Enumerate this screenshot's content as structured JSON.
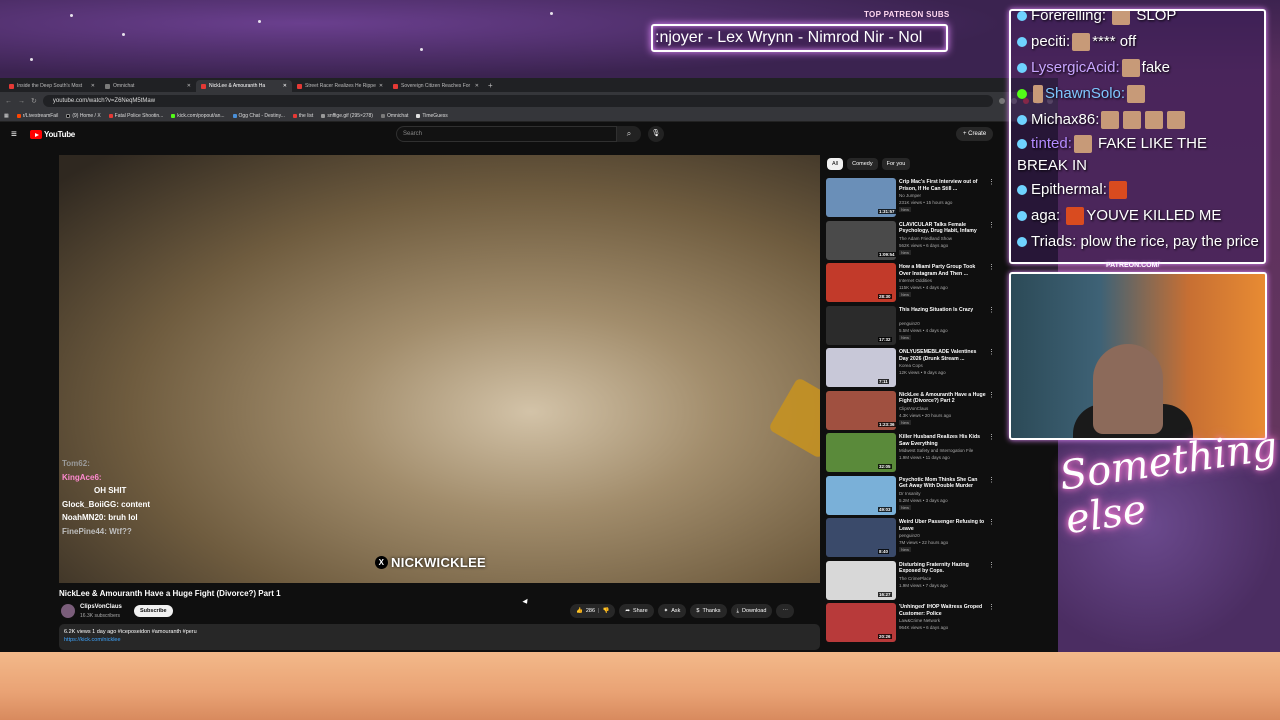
{
  "overlay": {
    "top_patreon_label": "TOP PATREON SUBS",
    "ticker_text": ":njoyer - Lex Wrynn - Nimrod Nir - Nol",
    "patreon_url": "PATREON.COM/",
    "signature_text": "Something else"
  },
  "browser": {
    "tabs": [
      {
        "label": "Inside the Deep South's Most"
      },
      {
        "label": "Omnichat"
      },
      {
        "label": "NickLee & Amouranth Ha",
        "active": true
      },
      {
        "label": "Street Racer Realizes He Rippe"
      },
      {
        "label": "Sovereign Citizen Reaches For"
      }
    ],
    "new_tab": "+",
    "url": "youtube.com/watch?v=Z6NeqM5tMaw",
    "bookmarks": [
      "r/LivestreamFail",
      "(9) Home / X",
      "Fatal Police Shootin...",
      "kick.com/popout/an...",
      "Ogg Chat - Destiny...",
      "the list",
      "snffige.gif (295×278)",
      "Omnichat",
      "TimeGuess"
    ]
  },
  "youtube": {
    "logo_text": "YouTube",
    "search_placeholder": "Search",
    "create_label": "+ Create",
    "video": {
      "overlay_chat": [
        {
          "text": "Tom62:",
          "color": "#9a9a9a"
        },
        {
          "text": "KingAce6:",
          "color": "#ff8ad0"
        },
        {
          "text": "",
          "color": "#d94040"
        },
        {
          "text": "OH SHIT",
          "color": "#ffffff"
        },
        {
          "text": "Glock_BoiiGG: content",
          "color": "#ffffff"
        },
        {
          "text": "",
          "color": "#d94040"
        },
        {
          "text": "NoahMN20: bruh lol",
          "color": "#ffffff"
        },
        {
          "text": "FinePine44: Wtf??",
          "color": "#bfbfbf"
        }
      ],
      "watermark": "NICKWICKLEE",
      "watermark_badge": "X"
    },
    "title": "NickLee & Amouranth Have a Huge Fight (Divorce?) Part 1",
    "channel": {
      "name": "ClipsVonClaus",
      "subs": "16.3K subscribers",
      "subscribe_label": "Subscribe"
    },
    "actions": {
      "likes": "286",
      "share": "Share",
      "ask": "Ask",
      "thanks": "Thanks",
      "download": "Download",
      "more": "⋯"
    },
    "description": {
      "stats": "6.2K views  1 day ago  #iceposeidon #amouranth #peru",
      "link": "https://kick.com/nicklee"
    },
    "chips": [
      {
        "label": "All",
        "active": true
      },
      {
        "label": "Comedy",
        "active": false
      },
      {
        "label": "For you",
        "active": false
      }
    ],
    "recommendations": [
      {
        "title": "Crip Mac's First Interview out of Prison, If He Can Still ...",
        "channel": "No Jumper",
        "meta": "231K views • 15 hours ago",
        "badge": "New",
        "duration": "1:31:57",
        "thumb": "#6a8fb8"
      },
      {
        "title": "CLAVICULAR Talks Female Psychology, Drug Habit, Infamy",
        "channel": "The Adam Friedland Show",
        "meta": "562K views • 6 days ago",
        "badge": "New",
        "duration": "1:09:54",
        "thumb": "#4a4a4a"
      },
      {
        "title": "How a Miami Party Group Took Over Instagram And Then ...",
        "channel": "Internet Oddities",
        "meta": "115K views • 4 days ago",
        "badge": "New",
        "duration": "28:30",
        "thumb": "#c23a2a"
      },
      {
        "title": "This Hazing Situation Is Crazy",
        "channel": "penguinz0",
        "meta": "5.5M views • 4 days ago",
        "badge": "New",
        "duration": "17:32",
        "thumb": "#2b2b2b"
      },
      {
        "title": "ONLYUSEMEBLADE Valentines Day 2026 (Drunk Stream ...",
        "channel": "Korea Cops",
        "meta": "12K views • 9 days ago",
        "badge": "",
        "duration": "7:11",
        "thumb": "#c8c8d8"
      },
      {
        "title": "NickLee & Amouranth Have a Huge Fight (Divorce?) Part 2",
        "channel": "ClipsVonClaus",
        "meta": "4.3K views • 20 hours ago",
        "badge": "New",
        "duration": "1:23:36",
        "thumb": "#a05040"
      },
      {
        "title": "Killer Husband Realizes His Kids Saw Everything",
        "channel": "Midwest Safety and Interrogation File",
        "meta": "1.9M views • 11 days ago",
        "badge": "",
        "duration": "32:05",
        "thumb": "#5a8a3a"
      },
      {
        "title": "Psychotic Mom Thinks She Can Get Away With Double Murder",
        "channel": "Dr Insanity",
        "meta": "5.2M views • 3 days ago",
        "badge": "New",
        "duration": "49:03",
        "thumb": "#7ab0d8"
      },
      {
        "title": "Weird Uber Passenger Refusing to Leave",
        "channel": "penguinz0",
        "meta": "7M views • 22 hours ago",
        "badge": "New",
        "duration": "8:40",
        "thumb": "#3a4a6a"
      },
      {
        "title": "Disturbing Fraternity Hazing Exposed by Cops.",
        "channel": "The CrimePlace",
        "meta": "1.9M views • 7 days ago",
        "badge": "",
        "duration": "16:27",
        "thumb": "#d8d8d8"
      },
      {
        "title": "'Unhinged' IHOP Waitress Groped Customer: Police",
        "channel": "Law&Crime Network",
        "meta": "964K views • 6 days ago",
        "badge": "",
        "duration": "20:26",
        "thumb": "#b83a3a"
      }
    ]
  },
  "stream_chat": [
    {
      "user": "Forerelling:",
      "msg": "SLOP",
      "color": "#ffffff"
    },
    {
      "user": "peciti:",
      "msg": "**** off",
      "color": "#ffffff"
    },
    {
      "user": "LysergicAcid:",
      "msg": "fake",
      "color": "#c8a6ff"
    },
    {
      "user": "ShawnSolo:",
      "msg": "",
      "color": "#7fc7ff"
    },
    {
      "user": "Michax86:",
      "msg": "",
      "color": "#ffffff"
    },
    {
      "user": "tinted:",
      "msg": "FAKE LIKE THE BREAK IN",
      "color": "#b48bff"
    },
    {
      "user": "Epithermal:",
      "msg": "",
      "color": "#ffffff"
    },
    {
      "user": "aga:",
      "msg": "YOUVE KILLED ME",
      "color": "#ffffff"
    },
    {
      "user": "Triads:",
      "msg": "plow the rice, pay the price",
      "color": "#ffffff"
    }
  ]
}
